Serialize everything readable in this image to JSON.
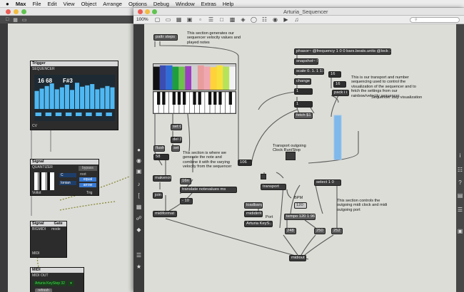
{
  "menubar": {
    "apple": "",
    "items": [
      "Max",
      "File",
      "Edit",
      "View",
      "Object",
      "Arrange",
      "Options",
      "Debug",
      "Window",
      "Extras",
      "Help"
    ]
  },
  "back_window": {
    "modules": {
      "trigger": {
        "title": "Trigger",
        "subtitle": "SEQUENCER",
        "value1": "16 68",
        "value2": "F#3",
        "cv": "CV"
      },
      "quantizer": {
        "title": "Signal",
        "name": "QUANTIZER",
        "bypass": "bypass",
        "key": "C",
        "scale": "Ionian",
        "root": "root",
        "equal": "equal",
        "arrow": "arrow",
        "left": "Voltot",
        "right": "Trig"
      },
      "bigmidi": {
        "in1": "Signal",
        "in2": "Gate",
        "name": "BIGMIDI",
        "mode": "mode",
        "out": "MIDI"
      },
      "midiout": {
        "title": "MIDI",
        "name": "MIDI OUT",
        "device": "Arturia KeyStep 32",
        "refresh": "refresh"
      }
    }
  },
  "window": {
    "title": "Arturia_Sequencer",
    "zoom": "100%",
    "search_placeholder": ""
  },
  "patch": {
    "objects": {
      "pattr": "pattr steps",
      "set0": "set 0",
      "del3": "del 3",
      "flush": "flush",
      "set": "set",
      "n58": "58",
      "makenote": "makenote",
      "n16n": "16n",
      "translate": "translate notevalues ms",
      "join": "join",
      "n10": "- 10",
      "midiformat": "midiformat",
      "n106": "106",
      "phasor": "phasor~ @frequency 1 0 0 bars.beats.units @lock 1",
      "snapshot": "snapshot~ 5",
      "scale": "scale 0. 1. 1 17",
      "change": "change",
      "n16a": "16",
      "n16b": "16",
      "p1": "1",
      "pack": "pack i i",
      "p1b": "1",
      "fetch": "fetch $1",
      "transport": "transport",
      "select": "select 1 0",
      "n120": "120",
      "loadbang": "loadbang",
      "mididinfo": "mididinfo",
      "arturia": "Arturia KeyS...",
      "tempo": "tempo 120 1 96",
      "n248": "248",
      "n250": "250",
      "n252": "252",
      "midiout": "midiout"
    },
    "comments": {
      "seq": "This section generates our sequencer velocity values and played notes",
      "transport_info": "This is our transport and number sequencing used to control the visualization of the sequencer and to fetch the settings from our rainbow/velocity sequencer.",
      "viz": "Sequencer step visualization",
      "combine": "This section is where we generate the note and combine it with the varying velocity from the sequencer",
      "clock": "Transport outgoing Clock Run/Stop",
      "bpm": "BPM",
      "port": "Port",
      "midi_out": "This section controls the outgoing midi clock and midi outgoing port"
    }
  },
  "colors": {
    "bars": [
      "#111111",
      "#3b4db3",
      "#2f6dd6",
      "#1f9e3d",
      "#6cc24a",
      "#9b3fc0",
      "#cfcfcf",
      "#e89c9c",
      "#f1a7b1",
      "#ffd23a",
      "#f7e03c",
      "#b6e35a",
      "#f2f2f2"
    ],
    "accent_blue": "#4fb8f2",
    "seq_viz": "#7fb8ea"
  },
  "seq_values": [
    0.55,
    0.62,
    0.7,
    0.78,
    0.6,
    0.66,
    0.74,
    0.58,
    0.8,
    0.68,
    0.72,
    0.76,
    0.6,
    0.64,
    0.7,
    0.66
  ]
}
